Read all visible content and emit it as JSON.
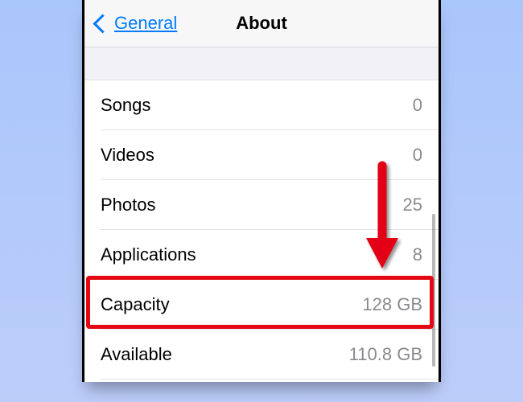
{
  "navbar": {
    "back_label": "General",
    "title": "About"
  },
  "rows": [
    {
      "label": "Songs",
      "value": "0"
    },
    {
      "label": "Videos",
      "value": "0"
    },
    {
      "label": "Photos",
      "value": "25"
    },
    {
      "label": "Applications",
      "value": "8"
    },
    {
      "label": "Capacity",
      "value": "128 GB"
    },
    {
      "label": "Available",
      "value": "110.8 GB"
    }
  ],
  "annotation": {
    "highlight_row_index": 4,
    "arrow_color": "#e30613"
  }
}
